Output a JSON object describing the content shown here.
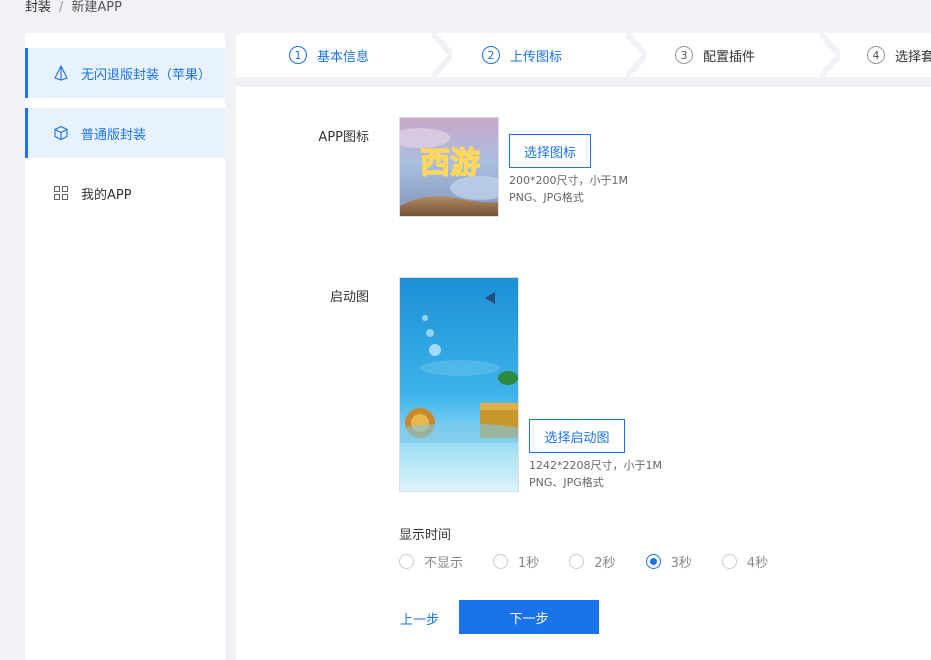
{
  "breadcrumb": {
    "root": "封装",
    "sep": "/",
    "current": "新建APP"
  },
  "sidebar": {
    "items": [
      {
        "label": "无闪退版封装（苹果）",
        "icon": "pyramid-icon"
      },
      {
        "label": "普通版封装",
        "icon": "cube-icon"
      },
      {
        "label": "我的APP",
        "icon": "grid-icon"
      }
    ]
  },
  "steps": [
    {
      "num": "1",
      "label": "基本信息",
      "state": "done"
    },
    {
      "num": "2",
      "label": "上传图标",
      "state": "done"
    },
    {
      "num": "3",
      "label": "配置插件",
      "state": "pending"
    },
    {
      "num": "4",
      "label": "选择套",
      "state": "pending"
    }
  ],
  "form": {
    "icon_label": "APP图标",
    "icon_button": "选择图标",
    "icon_hint_size": "200*200尺寸，小于1M",
    "icon_hint_format": "PNG、JPG格式",
    "splash_label": "启动图",
    "splash_button": "选择启动图",
    "splash_hint_size": "1242*2208尺寸，小于1M",
    "splash_hint_format": "PNG、JPG格式",
    "display_time_title": "显示时间",
    "display_options": [
      "不显示",
      "1秒",
      "2秒",
      "3秒",
      "4秒"
    ],
    "display_selected": "3秒",
    "prev_label": "上一步",
    "next_label": "下一步",
    "icon_art_text": "西游"
  },
  "colors": {
    "accent": "#1a73e8",
    "active_bg": "#e8f2fd"
  }
}
